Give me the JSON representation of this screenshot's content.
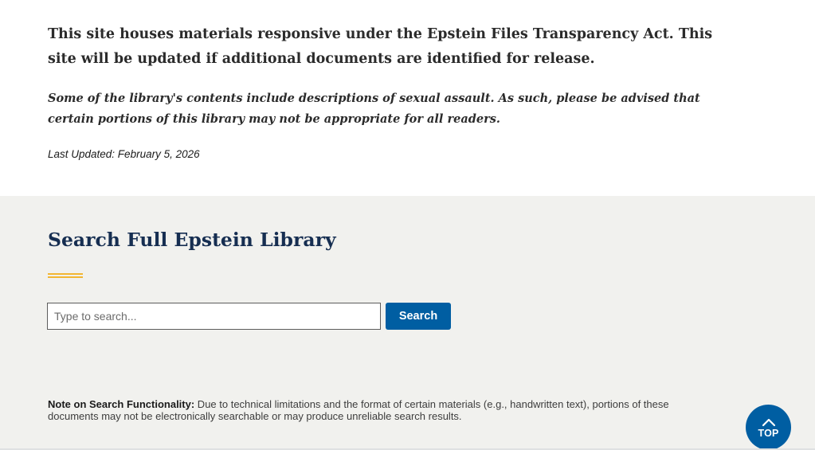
{
  "intro": {
    "lead": "This site houses materials responsive under the Epstein Files Transparency Act. This site will be updated if additional documents are identified for release.",
    "warning": "Some of the library's contents include descriptions of sexual assault. As such, please be advised that certain portions of this library may not be appropriate for all readers.",
    "last_updated": "Last Updated: February 5, 2026"
  },
  "search": {
    "title": "Search Full Epstein Library",
    "placeholder": "Type to search...",
    "value": "",
    "button_label": "Search",
    "note_label": "Note on Search Functionality:",
    "note_text": " Due to technical limitations and the format of certain materials (e.g., handwritten text), portions of these documents may not be electronically searchable or may produce unreliable search results."
  },
  "back_to_top": {
    "label": "TOP",
    "icon": "chevron-up-icon"
  },
  "colors": {
    "primary": "#005ea2",
    "heading": "#162e51",
    "accent": "#f2b632",
    "section_bg": "#f1f1ee"
  }
}
